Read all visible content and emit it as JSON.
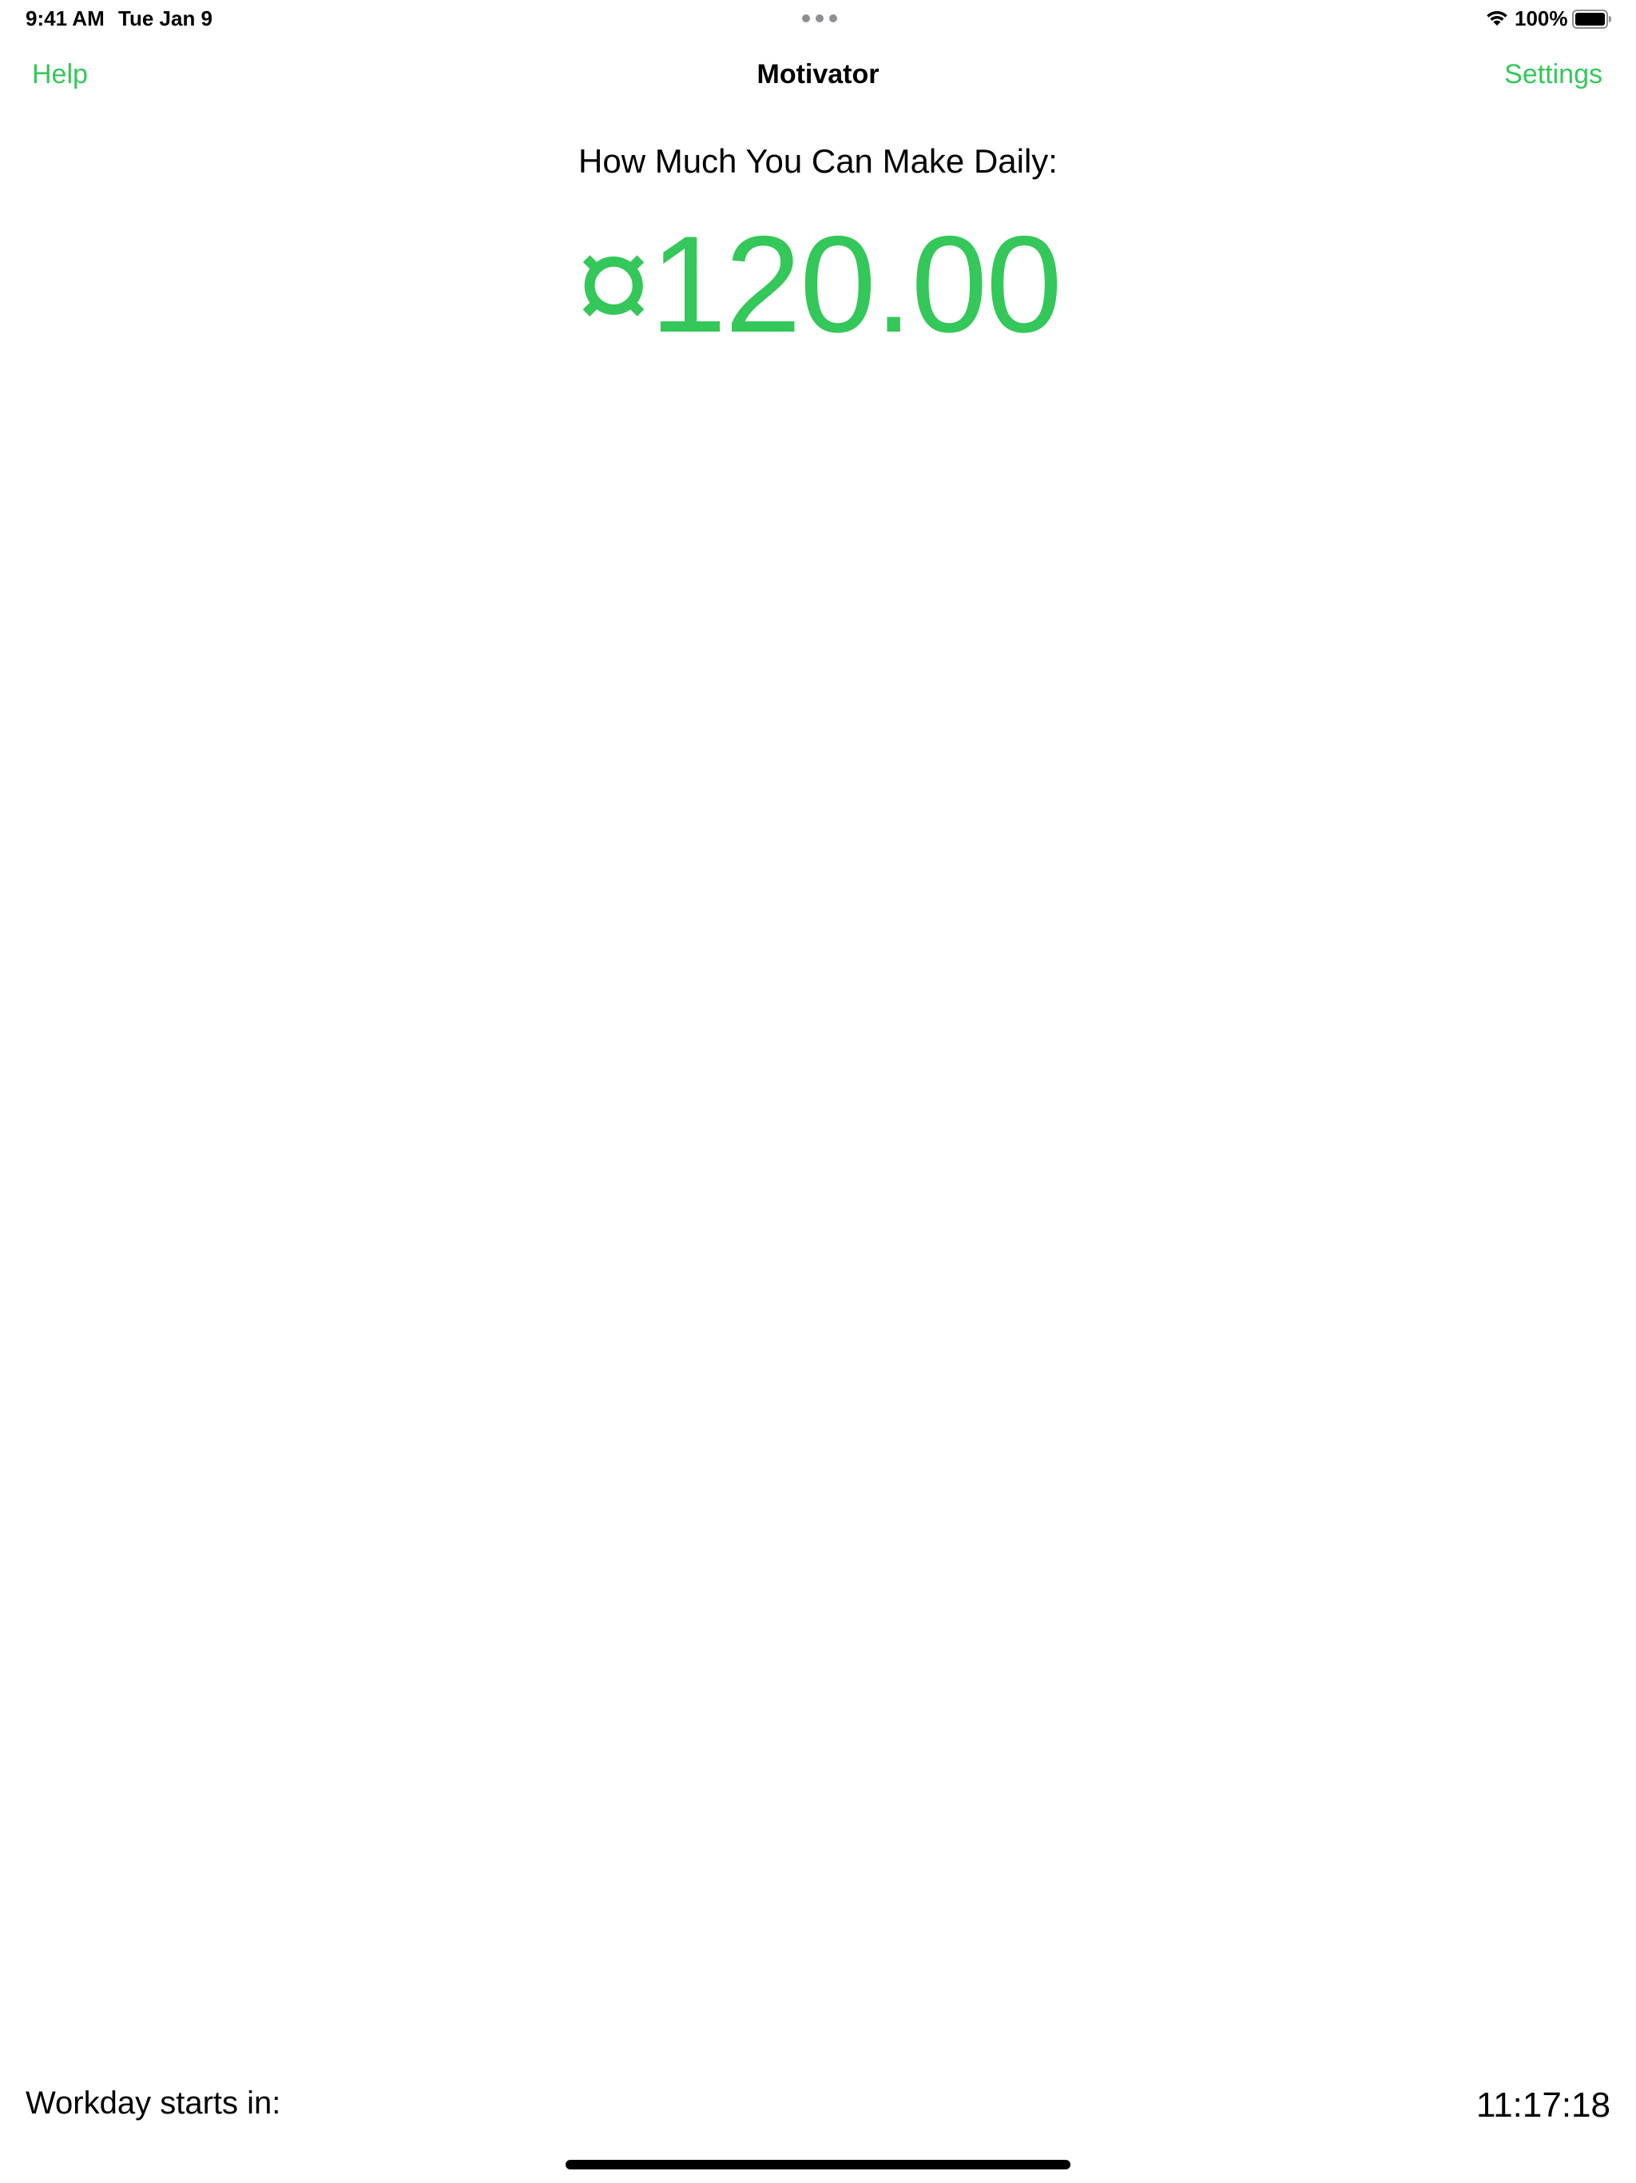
{
  "status_bar": {
    "time": "9:41 AM",
    "date": "Tue Jan 9",
    "battery_percent": "100%",
    "battery_level": 1.0,
    "icons": [
      "wifi-icon",
      "battery-icon"
    ]
  },
  "nav": {
    "left_button": "Help",
    "title": "Motivator",
    "right_button": "Settings"
  },
  "main": {
    "subtitle": "How Much You Can Make Daily:",
    "amount": "¤120.00"
  },
  "footer": {
    "label": "Workday starts in:",
    "countdown": "11:17:18"
  },
  "colors": {
    "accent": "#34c759",
    "text": "#000000",
    "background": "#ffffff"
  }
}
